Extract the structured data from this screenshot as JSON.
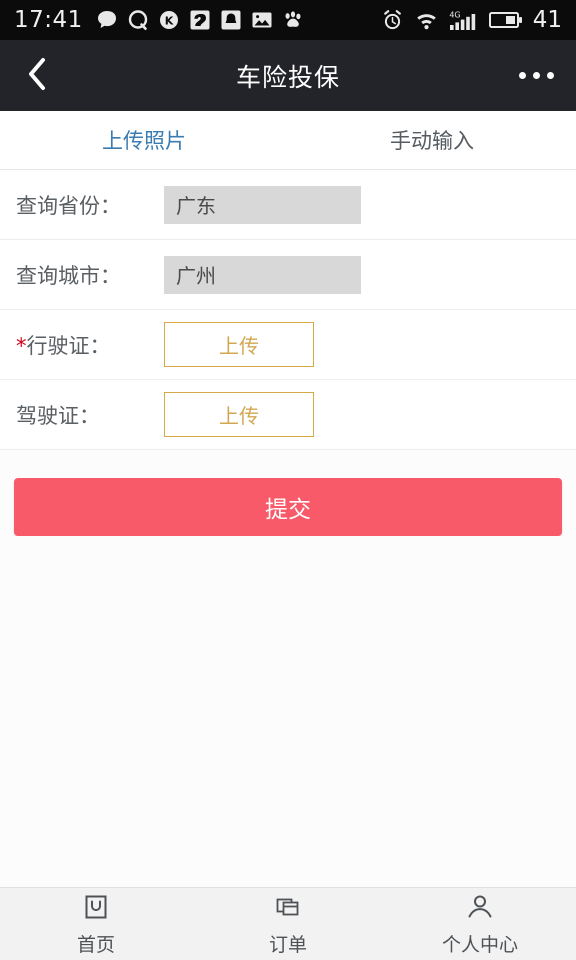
{
  "status_bar": {
    "time": "17:41",
    "battery_percent": "41",
    "left_icons": [
      "chat-bubble-icon",
      "qq-icon",
      "k-circle-icon",
      "squirrel-icon",
      "bell-icon",
      "photo-icon",
      "baidu-paw-icon"
    ],
    "right_icons": [
      "alarm-clock-icon",
      "wifi-icon",
      "signal-4g-icon",
      "battery-icon"
    ],
    "network_label": "4G",
    "background_color": "#0B0B0B"
  },
  "nav_bar": {
    "back_icon": "chevron-left-icon",
    "title": "车险投保",
    "more_icon": "more-dots-icon",
    "background_color": "#23232A"
  },
  "tabs": [
    {
      "label": "上传照片",
      "active": true
    },
    {
      "label": "手动输入",
      "active": false
    }
  ],
  "form": {
    "rows": [
      {
        "label": "查询省份：",
        "required": false,
        "type": "value",
        "value": "广东"
      },
      {
        "label": "查询城市：",
        "required": false,
        "type": "value",
        "value": "广州"
      },
      {
        "label": "行驶证：",
        "required": true,
        "required_mark": "*",
        "type": "upload",
        "value": "上传"
      },
      {
        "label": "驾驶证：",
        "required": false,
        "type": "upload",
        "value": "上传"
      }
    ]
  },
  "submit": {
    "label": "提交",
    "color": "#F85A69"
  },
  "bottom_nav": [
    {
      "label": "首页",
      "icon": "home-bag-icon"
    },
    {
      "label": "订单",
      "icon": "orders-cards-icon"
    },
    {
      "label": "个人中心",
      "icon": "person-icon"
    }
  ],
  "colors": {
    "accent_blue": "#3B7CB0",
    "upload_gold": "#D3A752",
    "submit_red": "#F85A69",
    "required_red": "#D0021B",
    "field_gray": "#D8D8D8"
  }
}
